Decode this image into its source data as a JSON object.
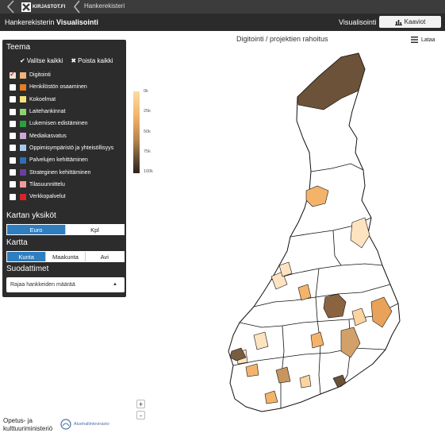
{
  "topbar": {
    "logo_text": "KIRJASTOT.FI",
    "breadcrumb": "Hankerekisteri"
  },
  "header": {
    "title_prefix": "Hankerekisterin",
    "title_bold": "Visualisointi",
    "nav_visualisointi": "Visualisointi",
    "nav_kaaviot": "Kaaviot"
  },
  "sidebar": {
    "teema_heading": "Teema",
    "select_all": "Valitse kaikki",
    "remove_all": "Poista kaikki",
    "themes": [
      {
        "label": "Digitointi",
        "color": "#f3b37a",
        "checked": true
      },
      {
        "label": "Henkilöstön osaaminen",
        "color": "#e67e22",
        "checked": false
      },
      {
        "label": "Kokoelmat",
        "color": "#f4e27a",
        "checked": false
      },
      {
        "label": "Laitehankinnat",
        "color": "#8fd46f",
        "checked": false
      },
      {
        "label": "Lukemisen edistäminen",
        "color": "#2e9e3e",
        "checked": false
      },
      {
        "label": "Mediakasvatus",
        "color": "#c9a9d9",
        "checked": false
      },
      {
        "label": "Oppimisympäristö ja yhteisöllisyys",
        "color": "#a9c8ea",
        "checked": false
      },
      {
        "label": "Palvelujen kehittäminen",
        "color": "#2e6fb7",
        "checked": false
      },
      {
        "label": "Strateginen kehittäminen",
        "color": "#6b3fa0",
        "checked": false
      },
      {
        "label": "Tilasuunnittelu",
        "color": "#f29b9b",
        "checked": false
      },
      {
        "label": "Verkkopalvelut",
        "color": "#d9232a",
        "checked": false
      }
    ],
    "yksikot_heading": "Kartan yksiköt",
    "yksikot": [
      {
        "label": "Euro",
        "active": true
      },
      {
        "label": "Kpl",
        "active": false
      }
    ],
    "kartta_heading": "Kartta",
    "kartta": [
      {
        "label": "Kunta",
        "active": true
      },
      {
        "label": "Maakunta",
        "active": false
      },
      {
        "label": "Avi",
        "active": false
      }
    ],
    "suodattimet_heading": "Suodattimet",
    "filter_value": "Rajaa hankkeiden määrää"
  },
  "map": {
    "title": "Digitointi / projektien rahoitus",
    "download_label": "Lataa",
    "legend_ticks": [
      "0k",
      "25k",
      "50k",
      "75k",
      "100k"
    ],
    "zoom_in": "+",
    "zoom_out": "-",
    "colors": {
      "low": "#fbdca2",
      "mid": "#f4b36a",
      "high": "#6b5238",
      "border": "#111111"
    }
  },
  "footer": {
    "ministry_line1": "Opetus- ja",
    "ministry_line2": "kulttuuriministeriö",
    "avi_label": "Aluehallintovirasto"
  }
}
